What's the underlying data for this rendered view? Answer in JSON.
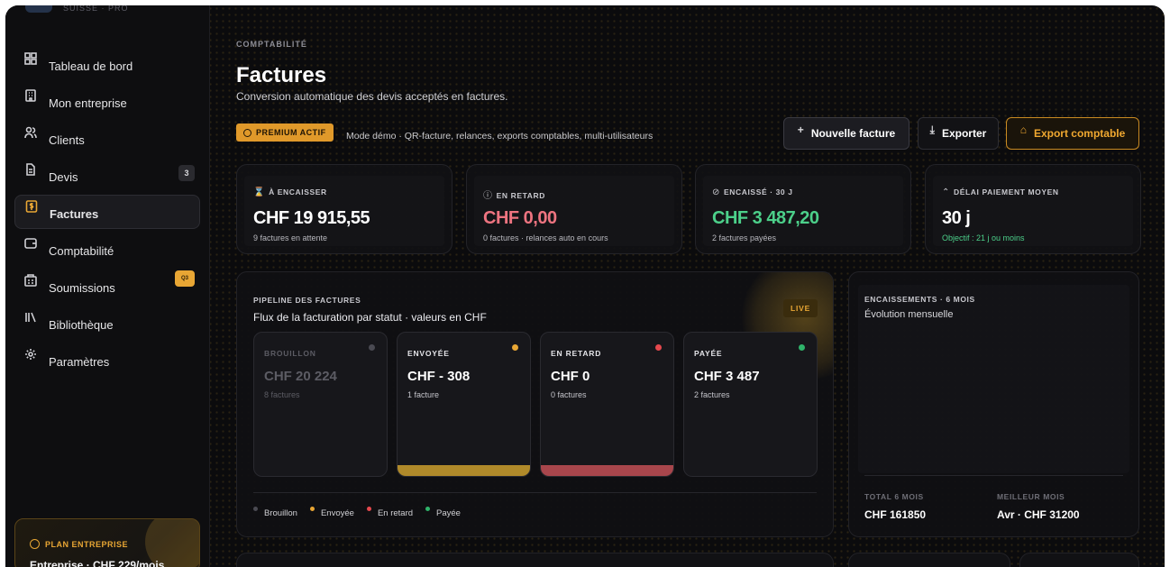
{
  "brand": {
    "subtitle": "SUISSE · PRO"
  },
  "sidebar": {
    "items": [
      {
        "label": "Tableau de bord",
        "icon": "dashboard-icon"
      },
      {
        "label": "Mon entreprise",
        "icon": "building-icon"
      },
      {
        "label": "Clients",
        "icon": "users-icon"
      },
      {
        "label": "Devis",
        "icon": "document-icon",
        "badge": "3"
      },
      {
        "label": "Factures",
        "icon": "invoice-icon",
        "active": true
      },
      {
        "label": "Comptabilité",
        "icon": "wallet-icon"
      },
      {
        "label": "Soumissions",
        "icon": "submissions-icon",
        "badge": "Q3"
      },
      {
        "label": "Bibliothèque",
        "icon": "library-icon"
      },
      {
        "label": "Paramètres",
        "icon": "gear-icon"
      }
    ]
  },
  "plan": {
    "title": "PLAN ENTREPRISE",
    "subtitle": "Entreprise · CHF 229/mois"
  },
  "header": {
    "eyebrow": "COMPTABILITÉ",
    "title": "Factures",
    "subtitle": "Conversion automatique des devis acceptés en factures.",
    "premium_badge": "PREMIUM ACTIF",
    "premium_note": "Mode démo · QR-facture, relances, exports comptables, multi-utilisateurs"
  },
  "actions": {
    "new_invoice": "Nouvelle facture",
    "export": "Exporter",
    "export_accounting": "Export comptable"
  },
  "kpis": [
    {
      "label": "À ENCAISSER",
      "icon": "hourglass-icon",
      "value": "CHF 19 915,55",
      "sub": "9 factures en attente",
      "value_color": "#ffffff",
      "sub_color": "#b8b8be"
    },
    {
      "label": "EN RETARD",
      "icon": "alert-icon",
      "value": "CHF 0,00",
      "sub": "0 factures · relances auto en cours",
      "value_color": "#ee7480",
      "sub_color": "#b8b8be"
    },
    {
      "label": "ENCAISSÉ · 30 J",
      "icon": "check-circle-icon",
      "value": "CHF 3 487,20",
      "sub": "2 factures payées",
      "value_color": "#4cd08a",
      "sub_color": "#b8b8be"
    },
    {
      "label": "DÉLAI PAIEMENT MOYEN",
      "icon": "trend-icon",
      "value": "30 j",
      "sub": "Objectif : 21 j ou moins",
      "value_color": "#ffffff",
      "sub_color": "#4cd08a"
    }
  ],
  "pipeline": {
    "label": "PIPELINE DES FACTURES",
    "description": "Flux de la facturation par statut · valeurs en CHF",
    "live": "LIVE",
    "stages": [
      {
        "name": "BROUILLON",
        "amount": "CHF 20 224",
        "count": "8 factures",
        "color": "#4a4a52",
        "bar": ""
      },
      {
        "name": "ENVOYÉE",
        "amount": "CHF - 308",
        "count": "1 facture",
        "color": "#e8a634",
        "bar": "#b08a2a"
      },
      {
        "name": "EN RETARD",
        "amount": "CHF 0",
        "count": "0 factures",
        "color": "#e5484d",
        "bar": "#a8464c"
      },
      {
        "name": "PAYÉE",
        "amount": "CHF 3 487",
        "count": "2 factures",
        "color": "#2fb36a",
        "bar": ""
      }
    ],
    "legend": [
      {
        "label": "Brouillon",
        "color": "#4a4a52"
      },
      {
        "label": "Envoyée",
        "color": "#e8a634"
      },
      {
        "label": "En retard",
        "color": "#e5484d"
      },
      {
        "label": "Payée",
        "color": "#2fb36a"
      }
    ]
  },
  "encaissements": {
    "label": "ENCAISSEMENTS · 6 MOIS",
    "description": "Évolution mensuelle",
    "total_label": "TOTAL 6 MOIS",
    "total_value": "CHF 161850",
    "best_label": "MEILLEUR MOIS",
    "best_value": "Avr · CHF 31200"
  }
}
